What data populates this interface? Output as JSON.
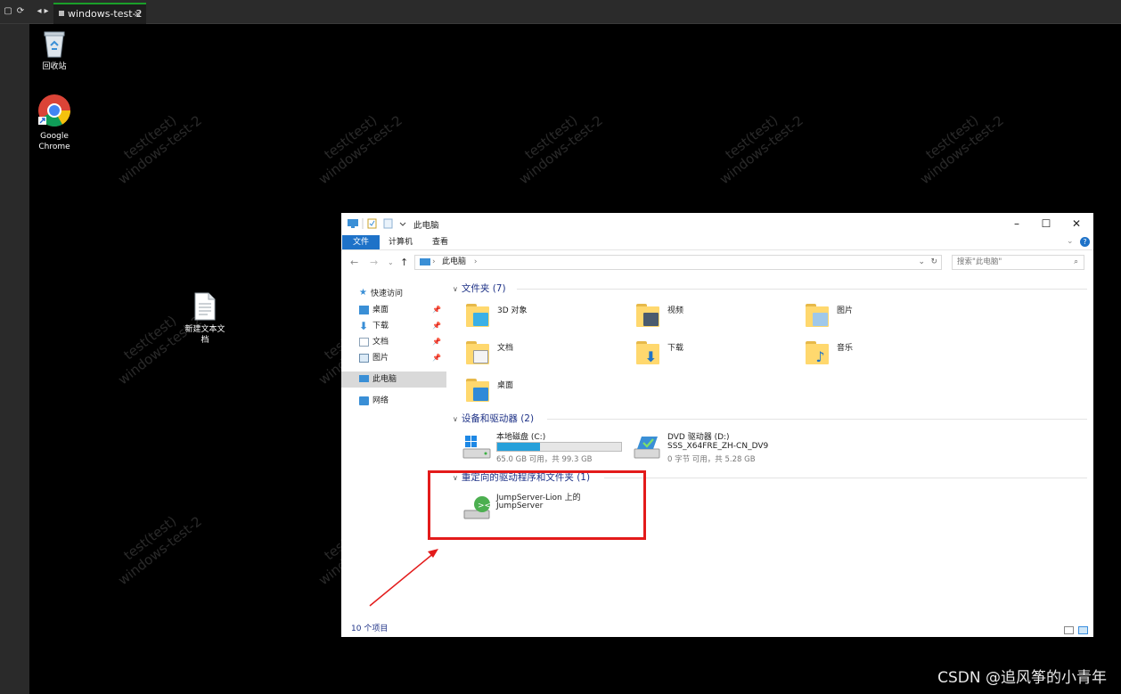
{
  "session": {
    "tab_label": "windows-test-2",
    "tab_close": "×"
  },
  "desktop": {
    "icons": [
      {
        "label": "回收站",
        "icon": "recycle-bin-icon"
      },
      {
        "label": "Google Chrome",
        "icon": "chrome-icon"
      },
      {
        "label": "新建文本文档",
        "icon": "text-document-icon"
      }
    ],
    "watermark": {
      "line1": "test(test)",
      "line2": "windows-test-2"
    }
  },
  "explorer": {
    "title": "此电脑",
    "ribbon_tabs": [
      "文件",
      "计算机",
      "查看"
    ],
    "address": "此电脑",
    "search_placeholder": "搜索\"此电脑\"",
    "nav": [
      {
        "label": "快速访问",
        "icon": "star-icon"
      },
      {
        "label": "桌面",
        "icon": "desktop-icon",
        "pinned": true
      },
      {
        "label": "下载",
        "icon": "download-icon",
        "pinned": true
      },
      {
        "label": "文档",
        "icon": "document-icon",
        "pinned": true
      },
      {
        "label": "图片",
        "icon": "picture-icon",
        "pinned": true
      },
      {
        "label": "此电脑",
        "icon": "computer-icon"
      },
      {
        "label": "网络",
        "icon": "network-icon"
      }
    ],
    "groups": {
      "folders": "文件夹 (7)",
      "devices": "设备和驱动器 (2)",
      "redirected": "重定向的驱动程序和文件夹 (1)"
    },
    "folders": [
      "3D 对象",
      "视频",
      "图片",
      "文档",
      "下载",
      "音乐",
      "桌面"
    ],
    "drives": [
      {
        "name": "本地磁盘 (C:)",
        "usage_text": "65.0 GB 可用，共 99.3 GB",
        "used_fraction": 0.345
      },
      {
        "name": "DVD 驱动器 (D:)",
        "label": "SSS_X64FRE_ZH-CN_DV9",
        "usage_text": "0 字节 可用，共 5.28 GB"
      }
    ],
    "redirected": {
      "line1": "JumpServer-Lion 上的",
      "line2": "JumpServer"
    },
    "status": "10 个项目"
  },
  "footer": {
    "credit": "CSDN @追风筝的小青年"
  },
  "colors": {
    "accent": "#1e72c8",
    "highlight": "#e31b1b",
    "tab_accent": "#1a9f29"
  }
}
